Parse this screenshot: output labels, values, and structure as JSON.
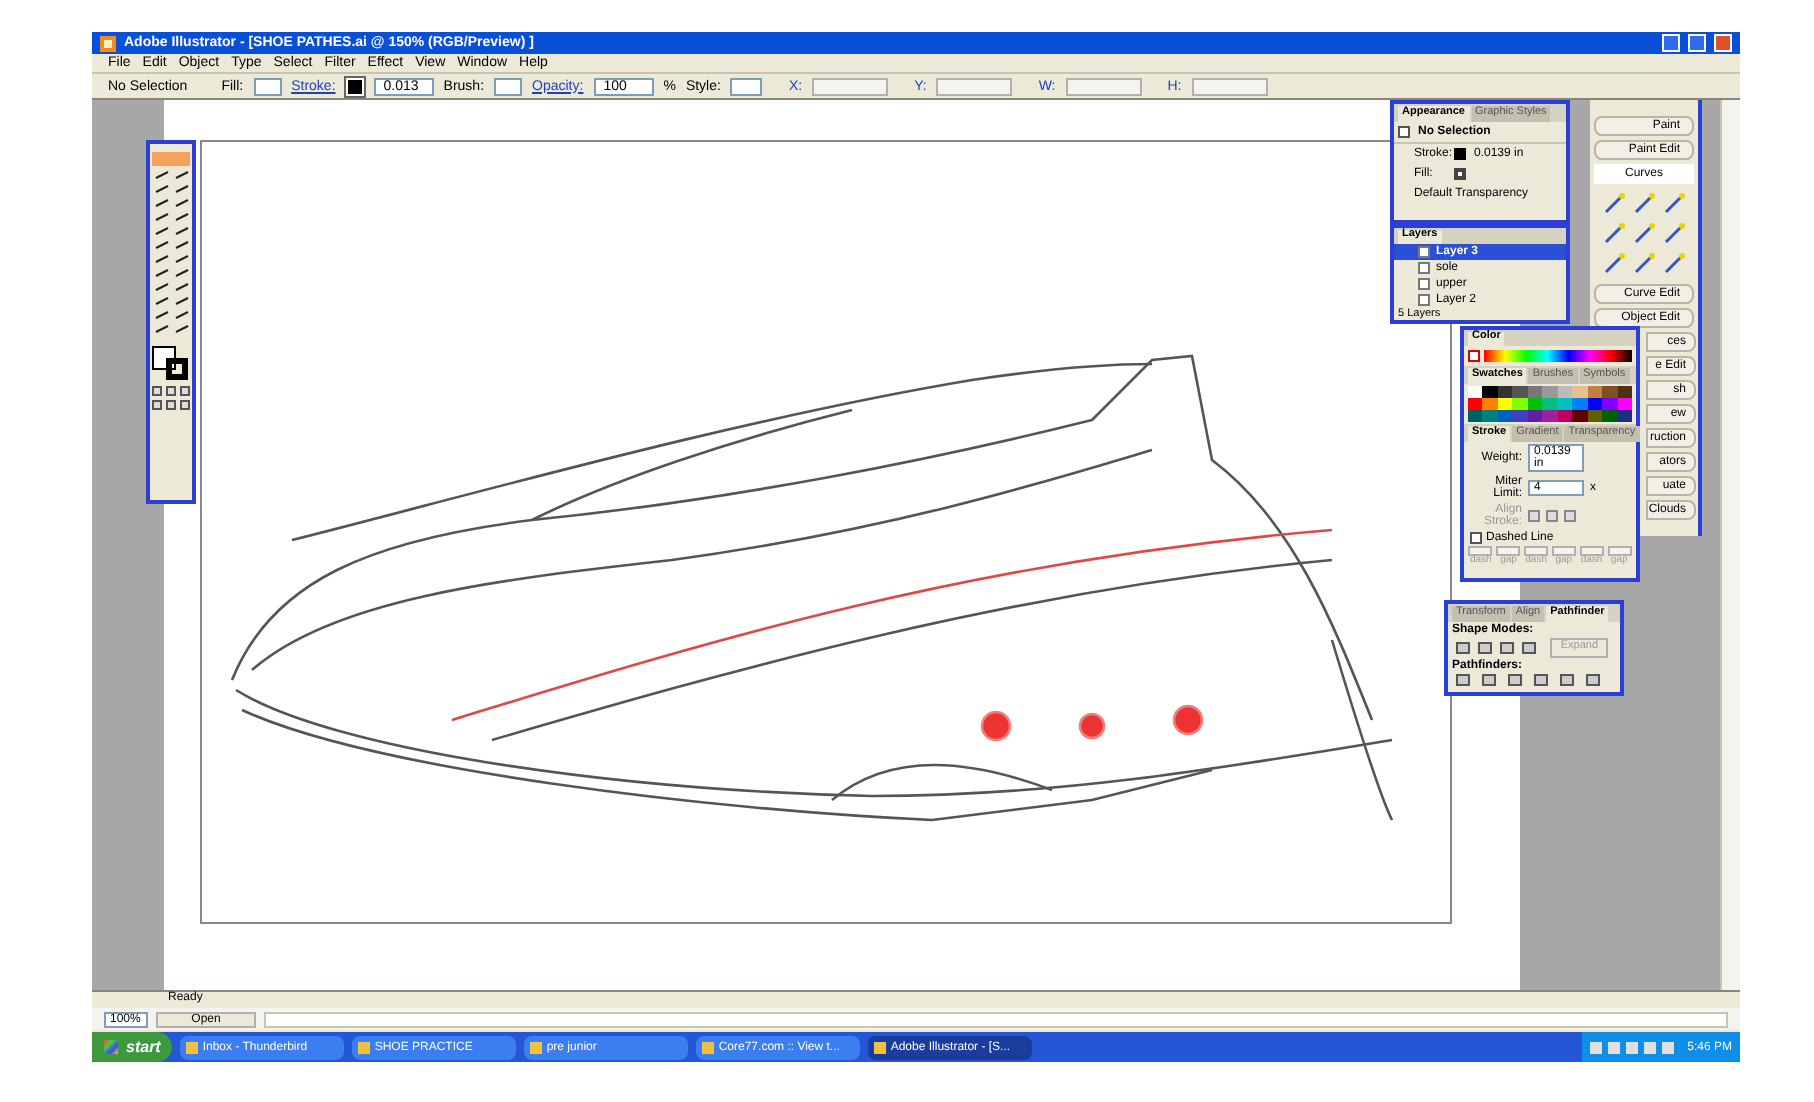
{
  "window": {
    "title": "Adobe Illustrator - [SHOE PATHES.ai @ 150% (RGB/Preview) ]"
  },
  "menu": [
    "File",
    "Edit",
    "Object",
    "Type",
    "Select",
    "Filter",
    "Effect",
    "View",
    "Window",
    "Help"
  ],
  "control_bar": {
    "selection": "No Selection",
    "fill_label": "Fill:",
    "stroke_label": "Stroke:",
    "stroke_weight": "0.013",
    "brush_label": "Brush:",
    "opacity_label": "Opacity:",
    "opacity": "100",
    "percent": "%",
    "style_label": "Style:",
    "coords": [
      "X:",
      "Y:",
      "W:",
      "H:"
    ]
  },
  "appearance": {
    "tabs": [
      {
        "label": "Appearance",
        "selected": true
      },
      {
        "label": "Graphic Styles",
        "selected": false
      }
    ],
    "heading": "No Selection",
    "rows": [
      {
        "label": "Stroke:",
        "kind": "stroke",
        "value": "0.0139 in"
      },
      {
        "label": "Fill:",
        "kind": "fill"
      }
    ],
    "footer": "Default Transparency"
  },
  "layers": {
    "tab": "Layers",
    "items": [
      {
        "name": "Layer 3",
        "selected": true
      },
      {
        "name": "sole",
        "selected": false
      },
      {
        "name": "upper",
        "selected": false
      },
      {
        "name": "Layer 2",
        "selected": false
      }
    ],
    "count": "5 Layers"
  },
  "dock": [
    {
      "label": "Paint",
      "kind": "button"
    },
    {
      "label": "Paint Edit",
      "kind": "button"
    },
    {
      "label": "Curves",
      "kind": "tab"
    },
    {
      "label": "Curve Edit",
      "kind": "button"
    },
    {
      "label": "Object Edit",
      "kind": "button"
    },
    {
      "label": "ces",
      "kind": "partial"
    },
    {
      "label": "e Edit",
      "kind": "partial"
    },
    {
      "label": "sh",
      "kind": "partial"
    },
    {
      "label": "ew",
      "kind": "partial"
    },
    {
      "label": "ruction",
      "kind": "partial"
    },
    {
      "label": "ators",
      "kind": "partial"
    },
    {
      "label": "uate",
      "kind": "partial"
    },
    {
      "label": "Clouds",
      "kind": "partial"
    }
  ],
  "color_panel": {
    "tab": "Color"
  },
  "swatches_panel": {
    "tabs": [
      {
        "label": "Swatches",
        "selected": true
      },
      {
        "label": "Brushes",
        "selected": false
      },
      {
        "label": "Symbols",
        "selected": false
      }
    ]
  },
  "stroke_panel": {
    "tabs": [
      {
        "label": "Stroke",
        "selected": true
      },
      {
        "label": "Gradient",
        "selected": false
      },
      {
        "label": "Transparency",
        "selected": false
      }
    ],
    "weight_label": "Weight:",
    "weight": "0.0139 in",
    "miter_label": "Miter Limit:",
    "miter": "4",
    "miter_unit": "x",
    "align_label": "Align Stroke:",
    "dashed": {
      "label": "Dashed Line",
      "checked": false
    },
    "dash_labels": [
      "dash",
      "gap",
      "dash",
      "gap",
      "dash",
      "gap"
    ]
  },
  "pathfinder": {
    "tabs": [
      {
        "label": "Transform",
        "selected": false
      },
      {
        "label": "Align",
        "selected": false
      },
      {
        "label": "Pathfinder",
        "selected": true
      }
    ],
    "shape_modes": "Shape Modes:",
    "expand": "Expand",
    "pathfinders": "Pathfinders:"
  },
  "status": {
    "ready": "Ready",
    "zoom": "100%",
    "text": "Open"
  },
  "taskbar": {
    "start": "start",
    "items": [
      {
        "label": "Inbox - Thunderbird",
        "selected": false
      },
      {
        "label": "SHOE PRACTICE",
        "selected": false
      },
      {
        "label": "pre junior",
        "selected": false
      },
      {
        "label": "Core77.com :: View t...",
        "selected": false
      },
      {
        "label": "Adobe Illustrator - [S...",
        "selected": true
      }
    ],
    "clock": "5:46 PM"
  }
}
